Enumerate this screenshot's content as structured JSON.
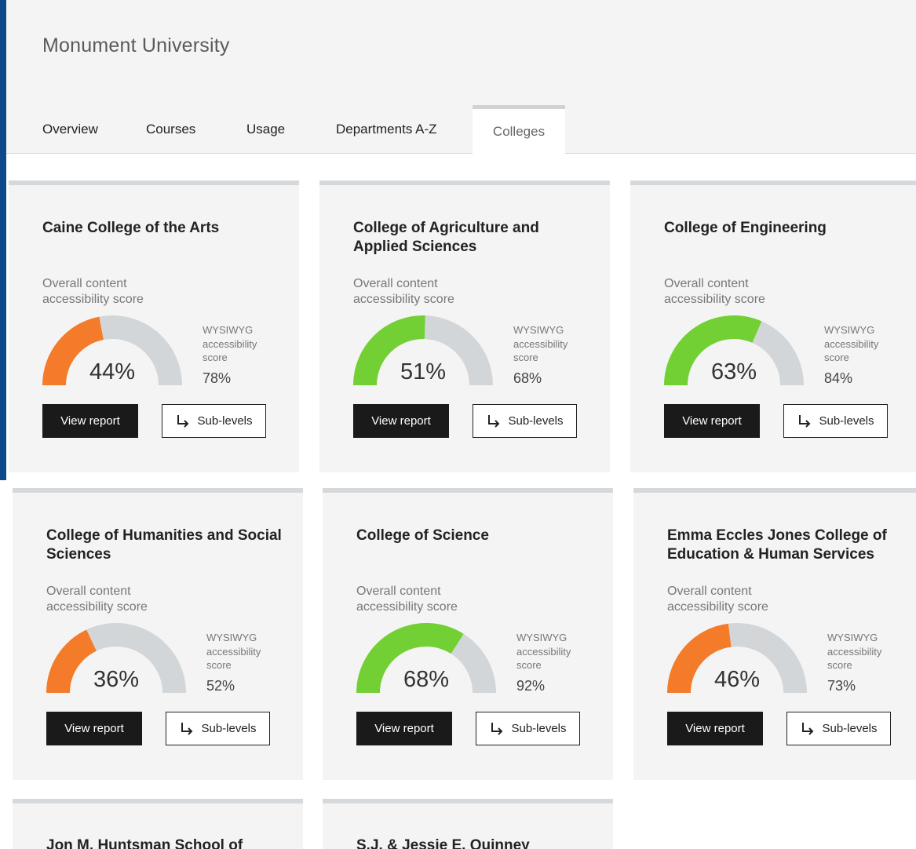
{
  "header": {
    "title": "Monument University",
    "tabs": [
      {
        "label": "Overview",
        "active": false
      },
      {
        "label": "Courses",
        "active": false
      },
      {
        "label": "Usage",
        "active": false
      },
      {
        "label": "Departments A-Z",
        "active": false
      },
      {
        "label": "Colleges",
        "active": true
      }
    ]
  },
  "labels": {
    "overall": "Overall content accessibility score",
    "wysiwyg": "WYSIWYG accessibility score",
    "view_report": "View report",
    "sub_levels": "Sub-levels"
  },
  "colors": {
    "low": "#f47b2a",
    "high": "#72d034",
    "track": "#d3d6d8"
  },
  "icons": {
    "sub_levels": "arrow-down-right-icon"
  },
  "colleges": [
    {
      "name": "Caine College of the Arts",
      "overall_score": 44,
      "overall_display": "44%",
      "wysiwyg_display": "78%",
      "status": "low"
    },
    {
      "name": "College of Agriculture and Applied Sciences",
      "overall_score": 51,
      "overall_display": "51%",
      "wysiwyg_display": "68%",
      "status": "high"
    },
    {
      "name": "College of Engineering",
      "overall_score": 63,
      "overall_display": "63%",
      "wysiwyg_display": "84%",
      "status": "high"
    },
    {
      "name": "College of Humanities and Social Sciences",
      "overall_score": 36,
      "overall_display": "36%",
      "wysiwyg_display": "52%",
      "status": "low"
    },
    {
      "name": "College of Science",
      "overall_score": 68,
      "overall_display": "68%",
      "wysiwyg_display": "92%",
      "status": "high"
    },
    {
      "name": "Emma Eccles Jones College of Education & Human Services",
      "overall_score": 46,
      "overall_display": "46%",
      "wysiwyg_display": "73%",
      "status": "low"
    },
    {
      "name": "Jon M. Huntsman School of"
    },
    {
      "name": "S.J. & Jessie E. Quinney"
    }
  ]
}
